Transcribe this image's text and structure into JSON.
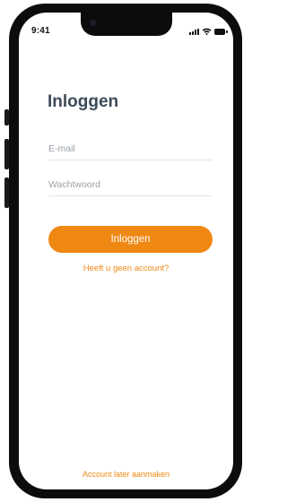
{
  "status_bar": {
    "time": "9:41",
    "icons": [
      "signal-icon",
      "wifi-icon",
      "battery-icon"
    ]
  },
  "login": {
    "title": "Inloggen",
    "email_placeholder": "E-mail",
    "password_placeholder": "Wachtwoord",
    "submit_label": "Inloggen",
    "no_account_link": "Heeft u geen account?",
    "create_later_link": "Account later aanmaken"
  },
  "colors": {
    "accent": "#ef8813",
    "title": "#3d4b5a",
    "placeholder": "#9aa1a9"
  }
}
